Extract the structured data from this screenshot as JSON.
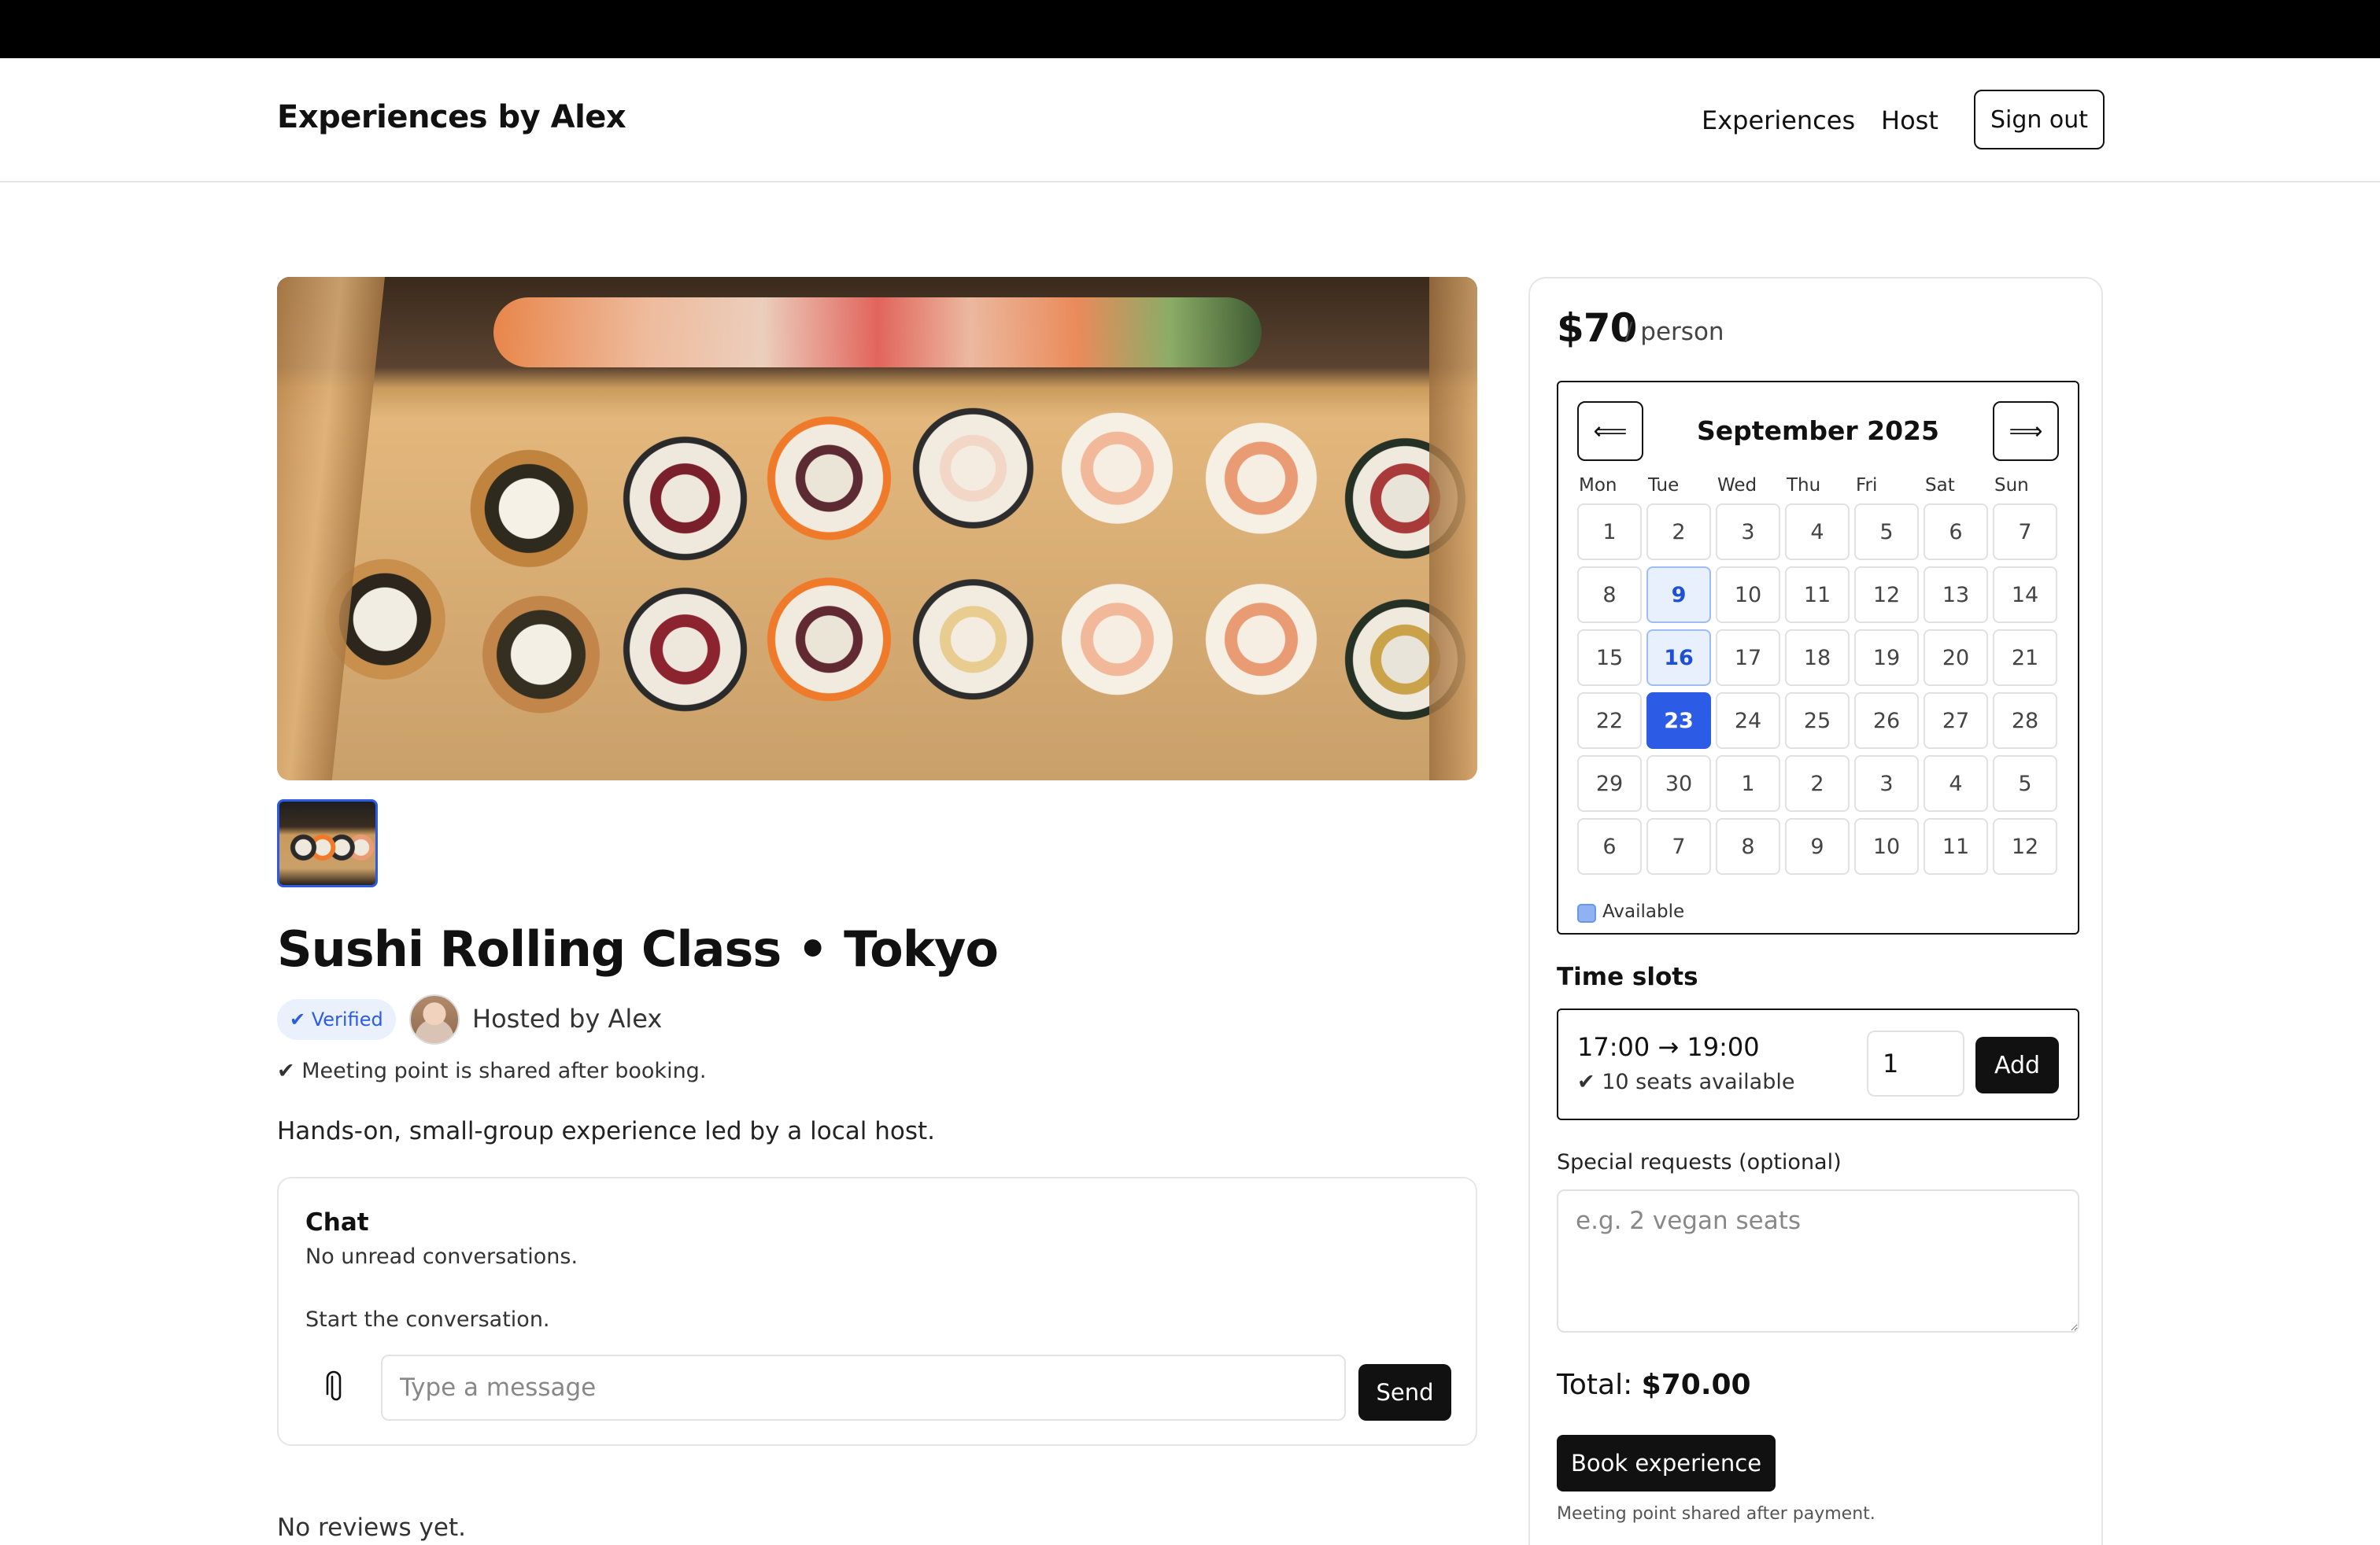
{
  "header": {
    "brand": "Experiences by Alex",
    "nav": [
      "Experiences",
      "Host"
    ],
    "signout_label": "Sign out"
  },
  "experience": {
    "title": "Sushi Rolling Class • Tokyo",
    "verified_label": "✔ Verified",
    "hosted_by": "Hosted by Alex",
    "meeting_note": "✔ Meeting point is shared after booking.",
    "description": "Hands-on, small-group experience led by a local host."
  },
  "chat": {
    "title": "Chat",
    "subtitle": "No unread conversations.",
    "start": "Start the conversation.",
    "input_placeholder": "Type a message",
    "send_label": "Send"
  },
  "reviews": {
    "empty": "No reviews yet."
  },
  "booking": {
    "price": "$70",
    "per": "/ person",
    "calendar": {
      "prev_label": "⟸",
      "next_label": "⟹",
      "month": "September 2025",
      "weekdays": [
        "Mon",
        "Tue",
        "Wed",
        "Thu",
        "Fri",
        "Sat",
        "Sun"
      ],
      "days": [
        [
          "1",
          "2",
          "3",
          "4",
          "5",
          "6",
          "7"
        ],
        [
          "8",
          "9",
          "10",
          "11",
          "12",
          "13",
          "14"
        ],
        [
          "15",
          "16",
          "17",
          "18",
          "19",
          "20",
          "21"
        ],
        [
          "22",
          "23",
          "24",
          "25",
          "26",
          "27",
          "28"
        ],
        [
          "29",
          "30",
          "1",
          "2",
          "3",
          "4",
          "5"
        ],
        [
          "6",
          "7",
          "8",
          "9",
          "10",
          "11",
          "12"
        ]
      ],
      "available": [
        "9",
        "16"
      ],
      "selected": "23",
      "legend": "Available"
    },
    "time_slots_title": "Time slots",
    "slot": {
      "time": "17:00 → 19:00",
      "seats": "✔ 10 seats available",
      "quantity": "1",
      "add_label": "Add"
    },
    "special_requests_label": "Special requests (optional)",
    "special_requests_placeholder": "e.g. 2 vegan seats",
    "total_label": "Total:",
    "total_value": "$70.00",
    "book_label": "Book experience",
    "payment_note": "Meeting point shared after payment."
  },
  "colors": {
    "accent": "#2c5ce6",
    "available_bg": "#e8f0fe",
    "primary_button": "#111111"
  }
}
